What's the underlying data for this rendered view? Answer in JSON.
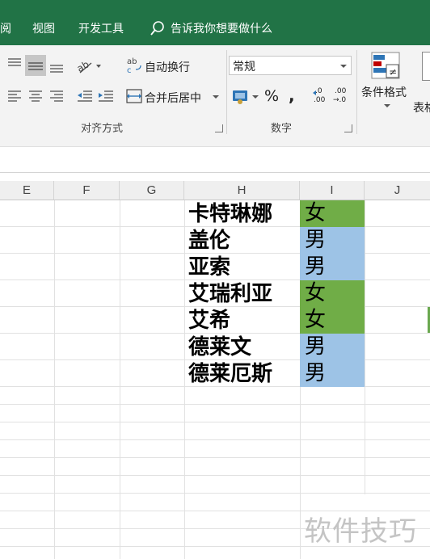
{
  "tabs": {
    "review": "阅",
    "view": "视图",
    "developer": "开发工具",
    "tell_me": "告诉我你想要做什么"
  },
  "ribbon": {
    "wrap_text": "自动换行",
    "merge_center": "合并后居中",
    "number_format": "常规",
    "percent": "%",
    "comma": ",",
    "conditional_format": "条件格式",
    "table_format_partial": "表格",
    "group_alignment": "对齐方式",
    "group_number": "数字",
    "dec_inc_top": ".0",
    "dec_inc_bottom": ".00",
    "dec_dec_top": ".00",
    "dec_dec_bottom": "→.0",
    "orientation_glyph": "ab"
  },
  "columns": [
    "E",
    "F",
    "G",
    "H",
    "I",
    "J"
  ],
  "rows": [
    {
      "name": "卡特琳娜",
      "gender": "女",
      "color": "#70ad47"
    },
    {
      "name": "盖伦",
      "gender": "男",
      "color": "#9dc3e6"
    },
    {
      "name": "亚索",
      "gender": "男",
      "color": "#9dc3e6"
    },
    {
      "name": "艾瑞利亚",
      "gender": "女",
      "color": "#70ad47"
    },
    {
      "name": "艾希",
      "gender": "女",
      "color": "#70ad47"
    },
    {
      "name": "德莱文",
      "gender": "男",
      "color": "#9dc3e6"
    },
    {
      "name": "德莱厄斯",
      "gender": "男",
      "color": "#9dc3e6"
    }
  ],
  "watermark": "软件技巧",
  "colors": {
    "ribbon_green": "#217346",
    "female_fill": "#70ad47",
    "male_fill": "#9dc3e6"
  }
}
